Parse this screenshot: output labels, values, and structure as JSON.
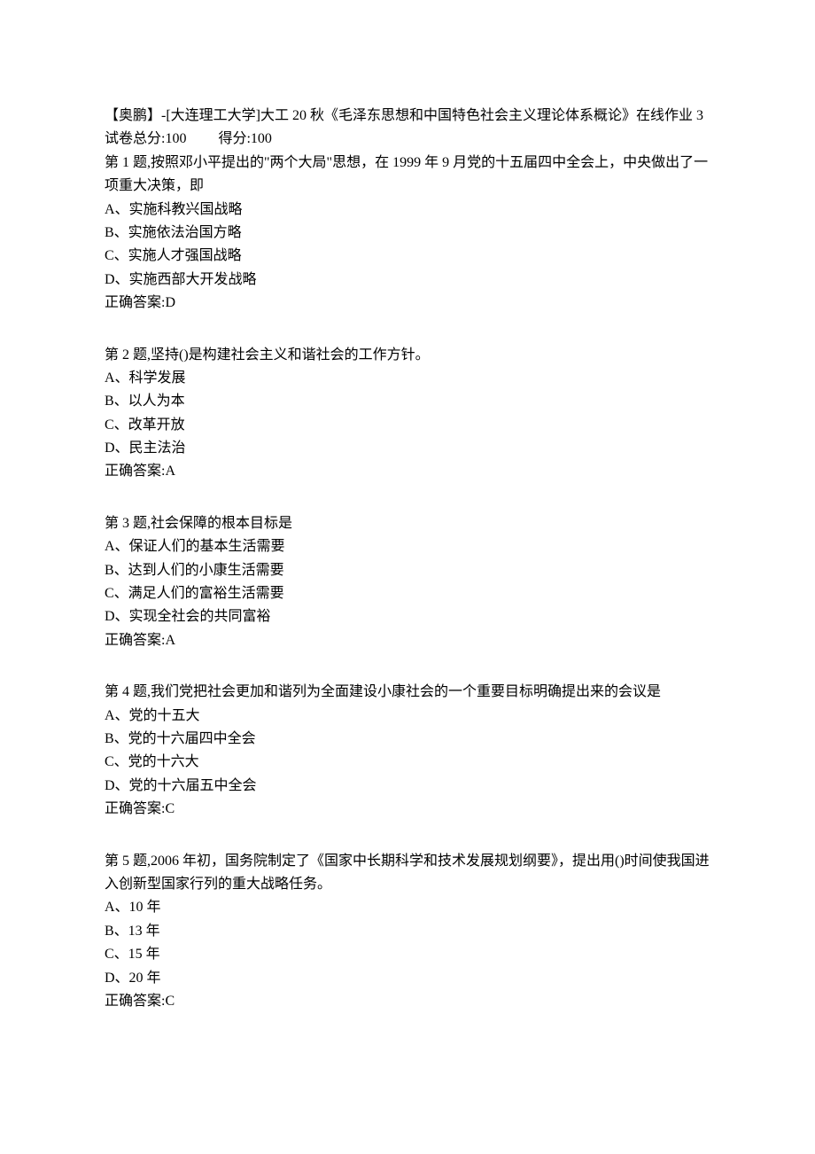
{
  "header": {
    "title": "【奥鹏】-[大连理工大学]大工 20 秋《毛泽东思想和中国特色社会主义理论体系概论》在线作业 3",
    "total_label": "试卷总分:100",
    "score_label": "得分:100"
  },
  "questions": [
    {
      "stem": "第 1 题,按照邓小平提出的\"两个大局\"思想，在 1999 年 9 月党的十五届四中全会上，中央做出了一项重大决策，即",
      "options": [
        "A、实施科教兴国战略",
        "B、实施依法治国方略",
        "C、实施人才强国战略",
        "D、实施西部大开发战略"
      ],
      "answer": "正确答案:D"
    },
    {
      "stem": "第 2 题,坚持()是构建社会主义和谐社会的工作方针。",
      "options": [
        "A、科学发展",
        "B、以人为本",
        "C、改革开放",
        "D、民主法治"
      ],
      "answer": "正确答案:A"
    },
    {
      "stem": "第 3 题,社会保障的根本目标是",
      "options": [
        "A、保证人们的基本生活需要",
        "B、达到人们的小康生活需要",
        "C、满足人们的富裕生活需要",
        "D、实现全社会的共同富裕"
      ],
      "answer": "正确答案:A"
    },
    {
      "stem": "第 4 题,我们党把社会更加和谐列为全面建设小康社会的一个重要目标明确提出来的会议是",
      "options": [
        "A、党的十五大",
        "B、党的十六届四中全会",
        "C、党的十六大",
        "D、党的十六届五中全会"
      ],
      "answer": "正确答案:C"
    },
    {
      "stem": "第 5 题,2006 年初，国务院制定了《国家中长期科学和技术发展规划纲要》，提出用()时间使我国进入创新型国家行列的重大战略任务。",
      "options": [
        "A、10 年",
        "B、13 年",
        "C、15 年",
        "D、20 年"
      ],
      "answer": "正确答案:C"
    }
  ]
}
